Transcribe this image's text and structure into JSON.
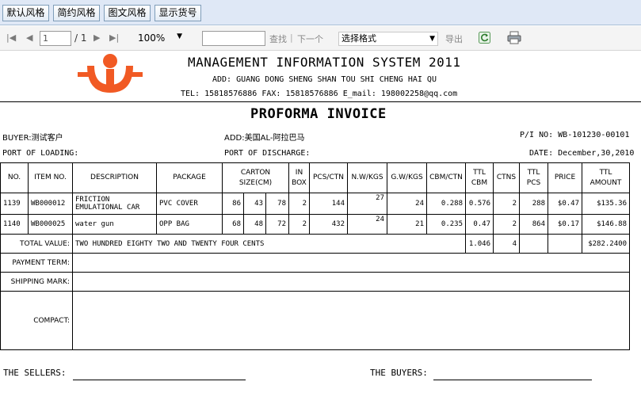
{
  "style_buttons": [
    "默认风格",
    "简约风格",
    "图文风格",
    "显示货号"
  ],
  "viewer": {
    "page_current": "1",
    "page_total": "/ 1",
    "zoom": "100%",
    "search_label": "查找",
    "next_label": "下一个",
    "format_select": "选择格式",
    "export_label": "导出"
  },
  "header": {
    "company": "MANAGEMENT INFORMATION SYSTEM 2011",
    "address": "ADD: GUANG DONG SHENG SHAN TOU SHI CHENG HAI QU",
    "contact": "TEL: 15818576886  FAX: 15818576886  E_mail: 198002258@qq.com"
  },
  "invoice": {
    "title": "PROFORMA INVOICE",
    "buyer": "BUYER:测试客户",
    "add": "ADD:美国AL-阿拉巴马",
    "pi_no": "P/I NO: WB-101230-00101",
    "port_loading": "PORT OF LOADING:",
    "port_discharge": "PORT OF DISCHARGE:",
    "date": "DATE: December,30,2010"
  },
  "table": {
    "headers": {
      "no": "NO.",
      "item_no": "ITEM NO.",
      "description": "DESCRIPTION",
      "package": "PACKAGE",
      "carton_line1": "CARTON",
      "carton_line2": "SIZE(CM)",
      "inbox_line1": "IN",
      "inbox_line2": "BOX",
      "pcs_ctn": "PCS/CTN",
      "nw": "N.W/KGS",
      "gw": "G.W/KGS",
      "cbm_ctn": "CBM/CTN",
      "ttl_cbm_line1": "TTL",
      "ttl_cbm_line2": "CBM",
      "ctns": "CTNS",
      "ttl_pcs_line1": "TTL",
      "ttl_pcs_line2": "PCS",
      "price": "PRICE",
      "amount_line1": "TTL",
      "amount_line2": "AMOUNT"
    },
    "rows": [
      {
        "no": "1139",
        "item_no": "WB000012",
        "description": "FRICTION EMULATIONAL CAR",
        "package": "PVC COVER",
        "l": "86",
        "w": "43",
        "h": "78",
        "inbox": "2",
        "pcs_ctn": "144",
        "nw": "27",
        "gw": "24",
        "cbm_ctn": "0.288",
        "ttl_cbm": "0.576",
        "ctns": "2",
        "ttl_pcs": "288",
        "price": "$0.47",
        "amount": "$135.36"
      },
      {
        "no": "1140",
        "item_no": "WB000025",
        "description": "water gun",
        "package": "OPP BAG",
        "l": "68",
        "w": "48",
        "h": "72",
        "inbox": "2",
        "pcs_ctn": "432",
        "nw": "24",
        "gw": "21",
        "cbm_ctn": "0.235",
        "ttl_cbm": "0.47",
        "ctns": "2",
        "ttl_pcs": "864",
        "price": "$0.17",
        "amount": "$146.88"
      }
    ],
    "total": {
      "label": "TOTAL VALUE:",
      "words": "TWO HUNDRED EIGHTY TWO AND TWENTY FOUR CENTS",
      "ttl_cbm": "1.046",
      "ctns": "4",
      "amount": "$282.2400"
    },
    "payment_term": "PAYMENT TERM:",
    "shipping_mark": "SHIPPING MARK:",
    "compact": "COMPACT:"
  },
  "signature": {
    "sellers": "THE SELLERS:",
    "buyers": "THE BUYERS:"
  }
}
